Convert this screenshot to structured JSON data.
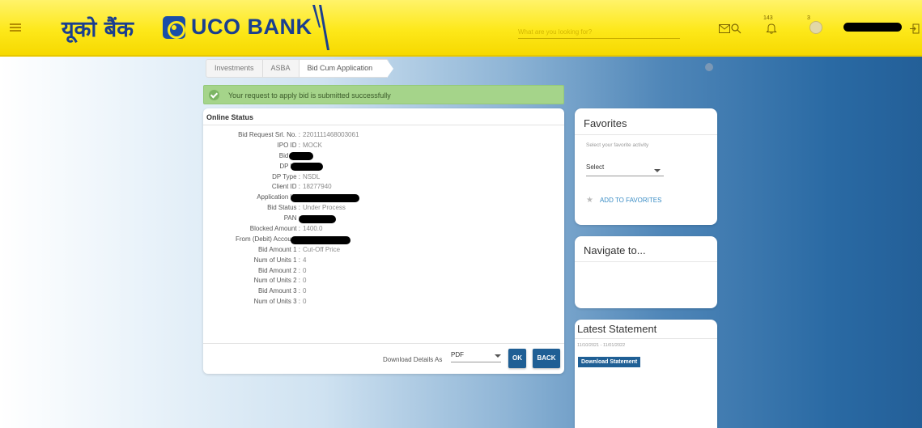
{
  "header": {
    "logo_hindi": "यूको बैंक",
    "logo_english": "UCO BANK",
    "search_placeholder": "What are you looking for?",
    "notification_count": "143",
    "profile_count": "3"
  },
  "breadcrumb": [
    "Investments",
    "ASBA",
    "Bid Cum Application"
  ],
  "success_message": "Your request to apply bid is submitted successfully",
  "online_status": {
    "title": "Online Status",
    "rows": [
      {
        "label": "Bid Request Srl. No. :",
        "value": "2201111468003061"
      },
      {
        "label": "IPO ID :",
        "value": "MOCK"
      },
      {
        "label": "Bid ID :",
        "value": ""
      },
      {
        "label": "DP ID :",
        "value": ""
      },
      {
        "label": "DP Type :",
        "value": "NSDL"
      },
      {
        "label": "Client ID :",
        "value": "18277940"
      },
      {
        "label": "Application ID :",
        "value": ""
      },
      {
        "label": "Bid Status :",
        "value": "Under Process"
      },
      {
        "label": "PAN :",
        "value": ""
      },
      {
        "label": "Blocked Amount :",
        "value": "1400.0"
      },
      {
        "label": "From (Debit) Account :",
        "value": ""
      },
      {
        "label": "Bid Amount 1 :",
        "value": "Cut-Off Price"
      },
      {
        "label": "Num of Units 1 :",
        "value": "4"
      },
      {
        "label": "Bid Amount 2 :",
        "value": "0"
      },
      {
        "label": "Num of Units 2 :",
        "value": "0"
      },
      {
        "label": "Bid Amount 3 :",
        "value": "0"
      },
      {
        "label": "Num of Units 3 :",
        "value": "0"
      }
    ],
    "download_label": "Download Details As",
    "download_format": "PDF",
    "ok_label": "OK",
    "back_label": "BACK"
  },
  "favorites": {
    "title": "Favorites",
    "hint": "Select your favorite activity",
    "select_value": "Select",
    "add_label": "ADD TO FAVORITES"
  },
  "navigate": {
    "title": "Navigate to..."
  },
  "latest_statement": {
    "title": "Latest Statement",
    "from_date": "11/10/2021",
    "to_date": "11/01/2022",
    "button_label": "Download Statement"
  },
  "colors": {
    "header_yellow": "#fde81a",
    "brand_blue": "#1a3f8f",
    "button_blue": "#1f5f95",
    "success_green": "#a5d48a",
    "link_blue": "#3a8dc5"
  }
}
